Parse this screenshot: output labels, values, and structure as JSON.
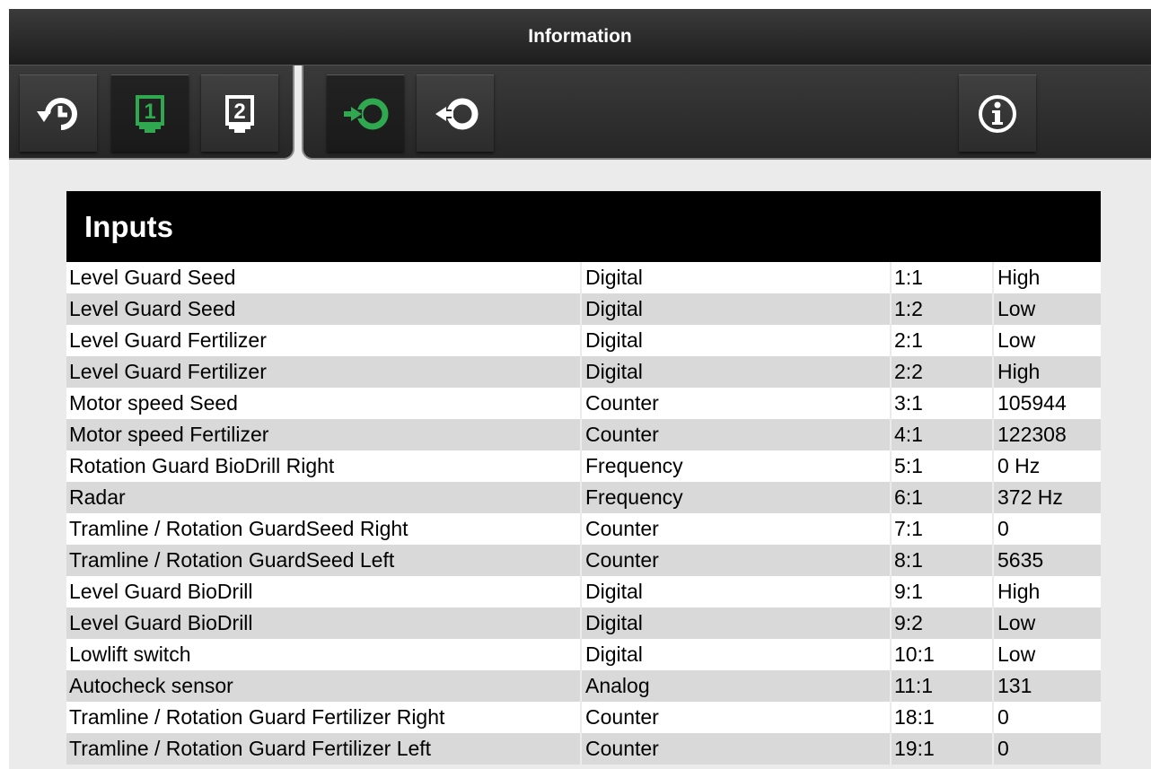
{
  "window": {
    "title": "Information"
  },
  "toolbar": {
    "left_buttons": [
      {
        "icon": "history-back-icon",
        "active": false
      },
      {
        "icon": "display-1-icon",
        "label": "1",
        "active": true
      },
      {
        "icon": "display-2-icon",
        "label": "2",
        "active": false
      }
    ],
    "right_buttons": [
      {
        "icon": "input-cycle-icon",
        "active": true
      },
      {
        "icon": "output-cycle-icon",
        "active": false
      },
      {
        "icon": "info-icon",
        "active": false
      }
    ]
  },
  "colors": {
    "accent_green": "#2fa84f",
    "header_bg": "#000000",
    "row_alt": "#d9d9d9"
  },
  "inputs": {
    "title": "Inputs",
    "rows": [
      {
        "name": "Level Guard Seed",
        "type": "Digital",
        "channel": "1:1",
        "value": "High"
      },
      {
        "name": "Level Guard Seed",
        "type": "Digital",
        "channel": "1:2",
        "value": "Low"
      },
      {
        "name": "Level Guard Fertilizer",
        "type": "Digital",
        "channel": "2:1",
        "value": "Low"
      },
      {
        "name": "Level Guard Fertilizer",
        "type": "Digital",
        "channel": "2:2",
        "value": "High"
      },
      {
        "name": "Motor speed Seed",
        "type": "Counter",
        "channel": "3:1",
        "value": "105944"
      },
      {
        "name": "Motor speed Fertilizer",
        "type": "Counter",
        "channel": "4:1",
        "value": "122308"
      },
      {
        "name": "Rotation Guard BioDrill Right",
        "type": "Frequency",
        "channel": "5:1",
        "value": "0 Hz"
      },
      {
        "name": "Radar",
        "type": "Frequency",
        "channel": "6:1",
        "value": "372 Hz"
      },
      {
        "name": "Tramline / Rotation GuardSeed Right",
        "type": "Counter",
        "channel": "7:1",
        "value": "0"
      },
      {
        "name": "Tramline / Rotation GuardSeed Left",
        "type": "Counter",
        "channel": "8:1",
        "value": "5635"
      },
      {
        "name": "Level Guard BioDrill",
        "type": "Digital",
        "channel": "9:1",
        "value": "High"
      },
      {
        "name": "Level Guard BioDrill",
        "type": "Digital",
        "channel": "9:2",
        "value": "Low"
      },
      {
        "name": "Lowlift switch",
        "type": "Digital",
        "channel": "10:1",
        "value": "Low"
      },
      {
        "name": "Autocheck sensor",
        "type": "Analog",
        "channel": "11:1",
        "value": "131"
      },
      {
        "name": "Tramline / Rotation Guard Fertilizer Right",
        "type": "Counter",
        "channel": "18:1",
        "value": "0"
      },
      {
        "name": "Tramline / Rotation Guard Fertilizer Left",
        "type": "Counter",
        "channel": "19:1",
        "value": "0"
      }
    ]
  }
}
